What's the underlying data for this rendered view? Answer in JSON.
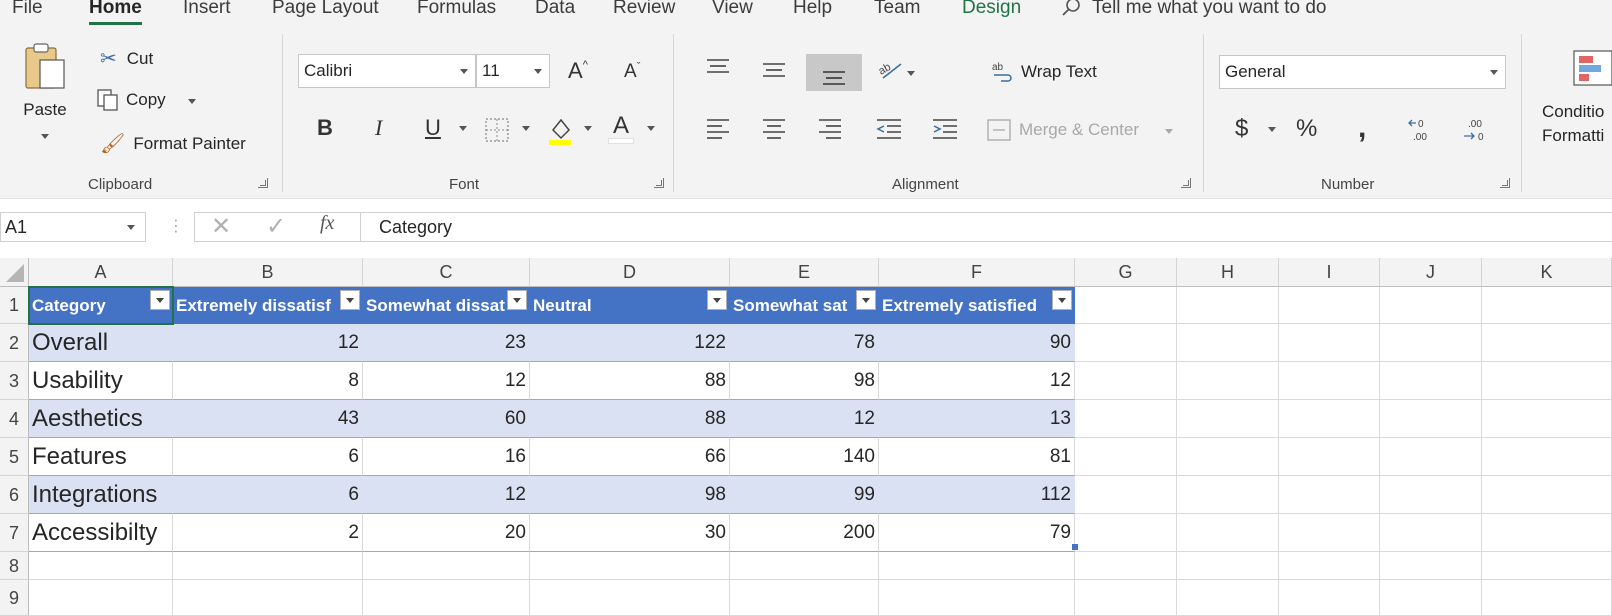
{
  "tabs": [
    "File",
    "Home",
    "Insert",
    "Page Layout",
    "Formulas",
    "Data",
    "Review",
    "View",
    "Help",
    "Team",
    "Design"
  ],
  "active_tab": "Home",
  "tell_me": "Tell me what you want to do",
  "clipboard": {
    "paste": "Paste",
    "cut": "Cut",
    "copy": "Copy",
    "format_painter": "Format Painter",
    "label": "Clipboard"
  },
  "font": {
    "name": "Calibri",
    "size": "11",
    "label": "Font",
    "bold": "B",
    "italic": "I",
    "underline": "U",
    "color_letter": "A"
  },
  "alignment": {
    "wrap_text": "Wrap Text",
    "merge_center": "Merge & Center",
    "label": "Alignment"
  },
  "number": {
    "format": "General",
    "label": "Number",
    "currency": "$",
    "percent": "%"
  },
  "conditional": {
    "line1": "Conditio",
    "line2": "Formatti"
  },
  "formula_bar": {
    "name_box": "A1",
    "fx": "fx",
    "content": "Category"
  },
  "columns": [
    "A",
    "B",
    "C",
    "D",
    "E",
    "F",
    "G",
    "H",
    "I",
    "J",
    "K"
  ],
  "row_numbers": [
    "1",
    "2",
    "3",
    "4",
    "5",
    "6",
    "7",
    "8",
    "9"
  ],
  "table": {
    "headers": [
      "Category",
      "Extremely dissatisf",
      "Somewhat dissat",
      "Neutral",
      "Somewhat sat",
      "Extremely satisfied"
    ],
    "rows": [
      [
        "Overall",
        "12",
        "23",
        "122",
        "78",
        "90"
      ],
      [
        "Usability",
        "8",
        "12",
        "88",
        "98",
        "12"
      ],
      [
        "Aesthetics",
        "43",
        "60",
        "88",
        "12",
        "13"
      ],
      [
        "Features",
        "6",
        "16",
        "66",
        "140",
        "81"
      ],
      [
        "Integrations",
        "6",
        "12",
        "98",
        "99",
        "112"
      ],
      [
        "Accessibilty",
        "2",
        "20",
        "30",
        "200",
        "79"
      ]
    ]
  },
  "colors": {
    "header_fill": "#4472c4",
    "band_fill": "#d9e1f2",
    "accent": "#217346"
  }
}
